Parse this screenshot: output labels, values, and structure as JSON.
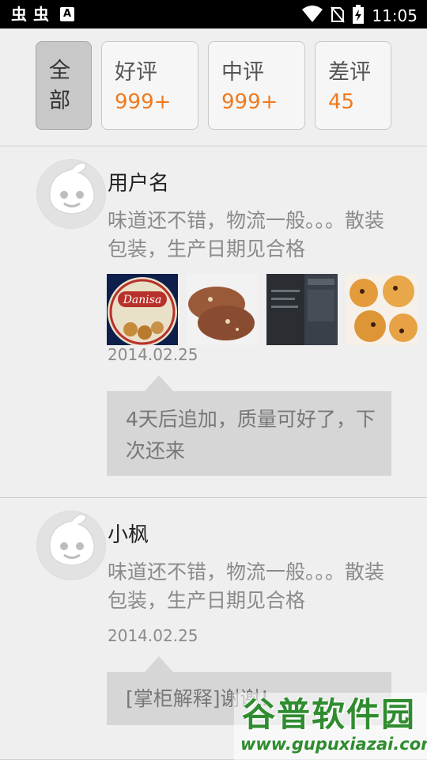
{
  "status_bar": {
    "left_icons": [
      "bug-icon",
      "bug-icon",
      "a-notification-icon"
    ],
    "right_icons": [
      "wifi-icon",
      "no-sim-icon",
      "battery-charging-icon"
    ],
    "time": "11:05",
    "a_icon_letter": "A",
    "bug_glyph": "虫"
  },
  "filters": {
    "all": "全部",
    "good": {
      "label": "好评",
      "count": "999+"
    },
    "mid": {
      "label": "中评",
      "count": "999+"
    },
    "bad": {
      "label": "差评",
      "count": "45"
    },
    "count_color": "#f07a1e"
  },
  "reviews": [
    {
      "username": "用户名",
      "content": "味道还不错，物流一般。。。散装包装，生产日期见合格",
      "photos": [
        {
          "name": "danisa-cookie-tin",
          "text": "Danisa"
        },
        {
          "name": "chocolate-cookies-photo"
        },
        {
          "name": "butter-cookies-box-photo"
        },
        {
          "name": "raisin-cookies-photo"
        }
      ],
      "date": "2014.02.25",
      "reply": "4天后追加，质量可好了，下次还来"
    },
    {
      "username": "小枫",
      "content": "味道还不错，物流一般。。。散装包装，生产日期见合格",
      "date": "2014.02.25",
      "reply": "[掌柜解释]谢谢！"
    }
  ],
  "watermark": {
    "title": "谷普软件园",
    "url": "www.gupuxiazai.com"
  }
}
